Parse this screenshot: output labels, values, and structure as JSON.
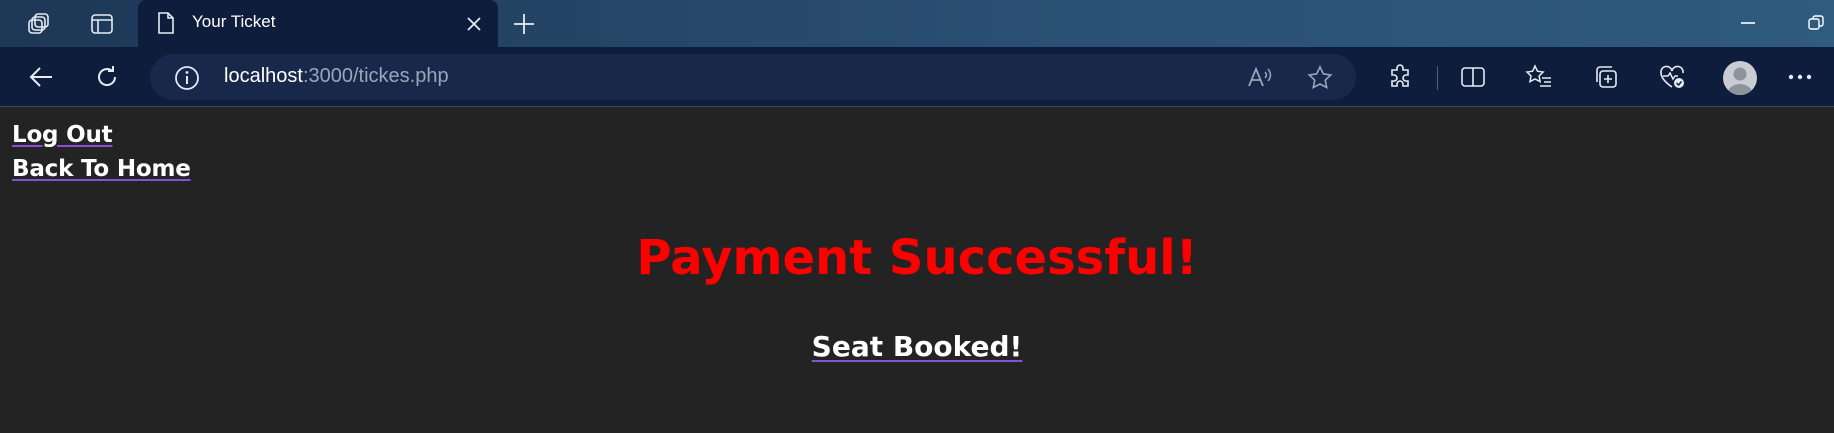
{
  "browser": {
    "tab": {
      "title": "Your Ticket"
    },
    "address": {
      "host": "localhost",
      "rest": ":3000/tickes.php"
    }
  },
  "page": {
    "links": {
      "logout": "Log Out",
      "home": "Back To Home"
    },
    "headline": "Payment Successful!",
    "subheadline": "Seat Booked!"
  },
  "colors": {
    "headline": "#ff0000",
    "link_underline": "#8a4dd8",
    "page_bg": "#232323"
  },
  "icons": {
    "tab_actions": "tab-actions-icon",
    "vertical_tabs": "vertical-tabs-icon",
    "document": "document-icon",
    "close": "close-icon",
    "new_tab": "plus-icon",
    "minimize": "minimize-icon",
    "restore": "restore-icon",
    "back": "back-arrow-icon",
    "refresh": "refresh-icon",
    "info": "info-icon",
    "read_aloud": "read-aloud-icon",
    "favorite": "star-icon",
    "extensions": "puzzle-icon",
    "split_screen": "split-screen-icon",
    "favorites": "favorites-list-icon",
    "collections": "collections-icon",
    "health": "browser-essentials-icon",
    "profile": "profile-avatar-icon",
    "menu": "more-menu-icon"
  }
}
